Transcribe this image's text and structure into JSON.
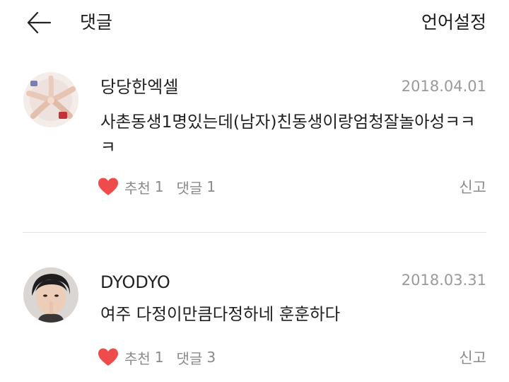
{
  "header": {
    "back_icon": "arrow-left-icon",
    "title": "댓글",
    "language_label": "언어설정"
  },
  "comments": [
    {
      "author": "당당한엑셀",
      "date": "2018.04.01",
      "text": "사촌동생1명있는데(남자)친동생이랑엄청잘놀아성ㅋㅋㅋ",
      "like_icon": "heart-icon",
      "like_label": "추천",
      "like_count": "1",
      "reply_label": "댓글",
      "reply_count": "1",
      "report_label": "신고",
      "heart_color": "#f04b4b"
    },
    {
      "author": "DYODYO",
      "date": "2018.03.31",
      "text": "여주 다정이만큼다정하네 훈훈하다",
      "like_icon": "heart-icon",
      "like_label": "추천",
      "like_count": "1",
      "reply_label": "댓글",
      "reply_count": "3",
      "report_label": "신고",
      "heart_color": "#f04b4b"
    }
  ]
}
